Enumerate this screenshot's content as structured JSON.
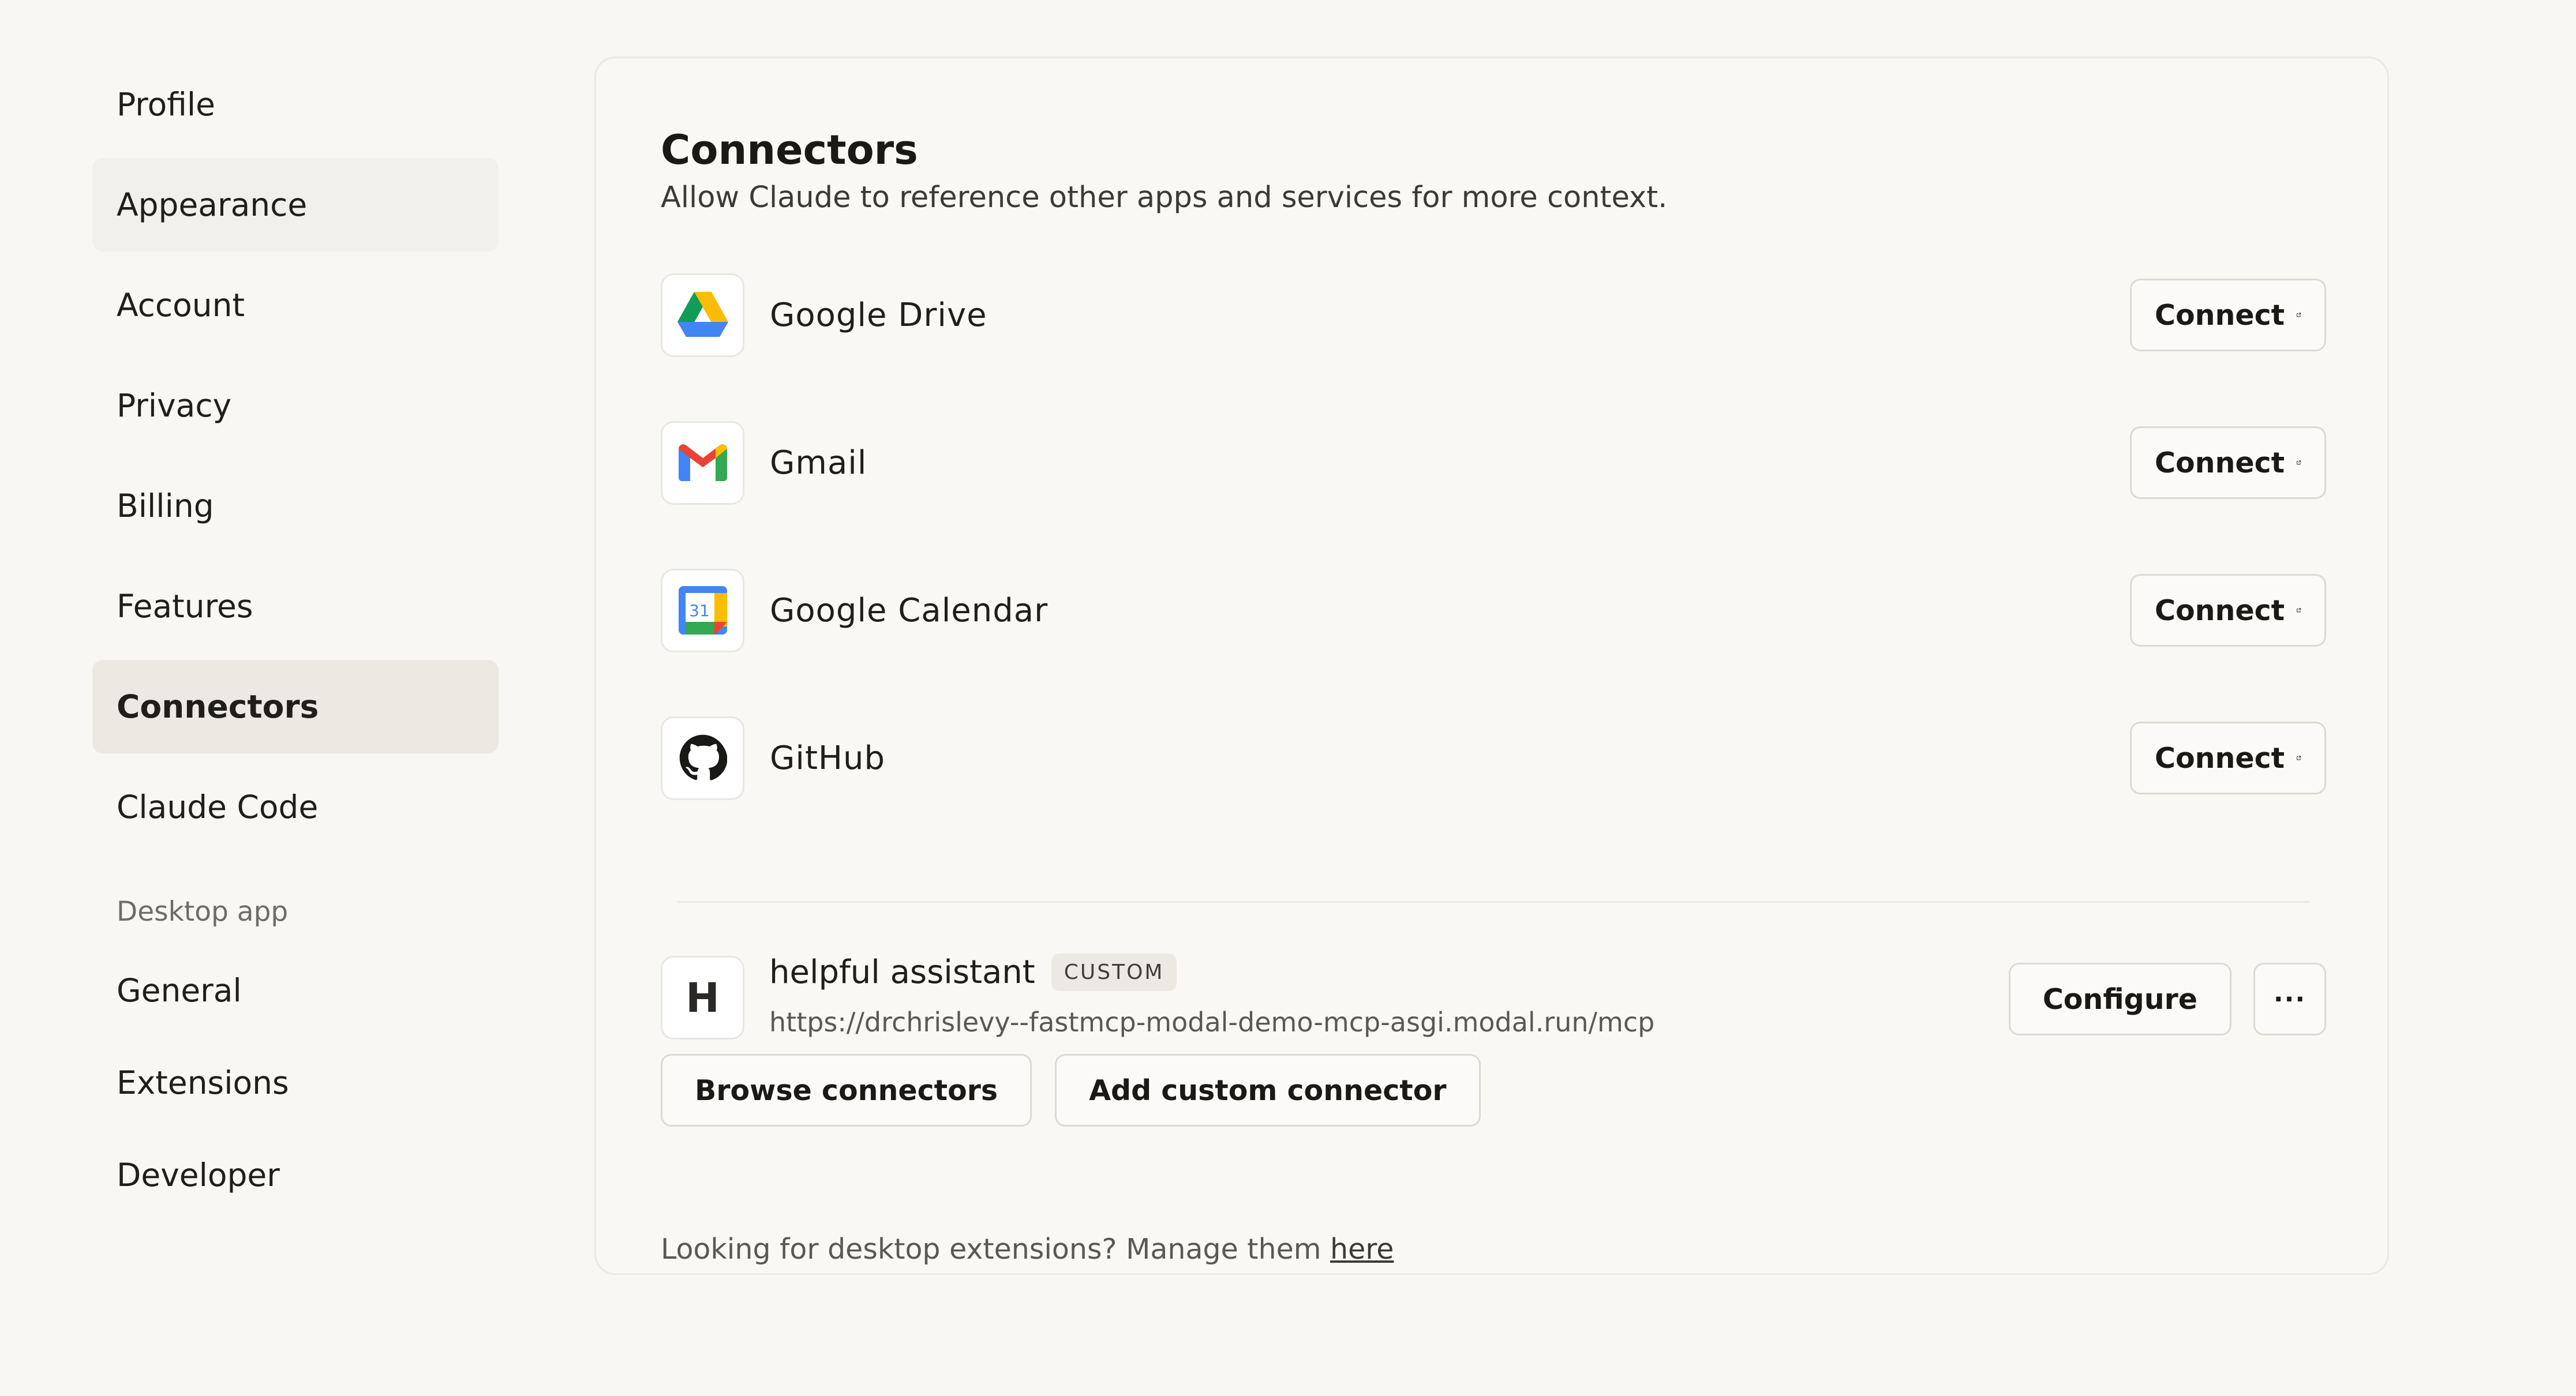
{
  "sidebar": {
    "items": [
      {
        "label": "Profile"
      },
      {
        "label": "Appearance"
      },
      {
        "label": "Account"
      },
      {
        "label": "Privacy"
      },
      {
        "label": "Billing"
      },
      {
        "label": "Features"
      },
      {
        "label": "Connectors"
      },
      {
        "label": "Claude Code"
      }
    ],
    "desktop_section_label": "Desktop app",
    "desktop_items": [
      {
        "label": "General"
      },
      {
        "label": "Extensions"
      },
      {
        "label": "Developer"
      }
    ]
  },
  "main": {
    "title": "Connectors",
    "subtitle": "Allow Claude to reference other apps and services for more context.",
    "connectors": [
      {
        "name": "Google Drive",
        "icon": "google-drive-icon",
        "button": "Connect"
      },
      {
        "name": "Gmail",
        "icon": "gmail-icon",
        "button": "Connect"
      },
      {
        "name": "Google Calendar",
        "icon": "google-calendar-icon",
        "button": "Connect",
        "icon_text": "31"
      },
      {
        "name": "GitHub",
        "icon": "github-icon",
        "button": "Connect"
      }
    ],
    "custom_connector": {
      "icon_letter": "H",
      "name": "helpful assistant",
      "badge": "CUSTOM",
      "url": "https://drchrislevy--fastmcp-modal-demo-mcp-asgi.modal.run/mcp",
      "configure_label": "Configure",
      "more_label": "···"
    },
    "browse_label": "Browse connectors",
    "add_custom_label": "Add custom connector",
    "footer_text": "Looking for desktop extensions? Manage them ",
    "footer_link": "here"
  },
  "colors": {
    "background": "#f8f7f4",
    "active_nav": "#ebe9e1",
    "card_border": "#ebe9e3"
  }
}
